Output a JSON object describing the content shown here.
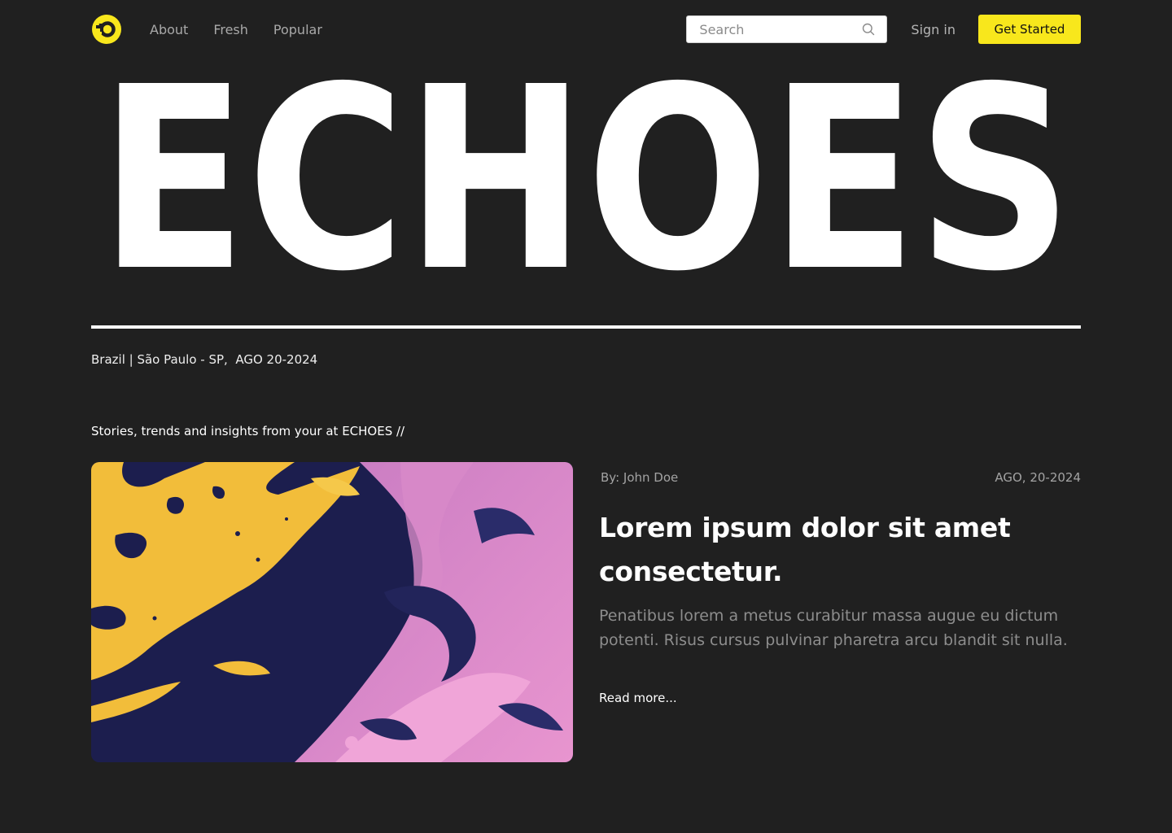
{
  "header": {
    "nav": [
      {
        "label": "About"
      },
      {
        "label": "Fresh"
      },
      {
        "label": "Popular"
      }
    ],
    "search": {
      "placeholder": "Search"
    },
    "signin_label": "Sign in",
    "cta_label": "Get Started"
  },
  "hero": {
    "title": "ECHOES",
    "location": "Brazil | São Paulo - SP,  AGO 20-2024",
    "tagline": "Stories, trends and insights from your at ECHOES //"
  },
  "feature": {
    "author": "By: John Doe",
    "date": "AGO, 20-2024",
    "title": "Lorem ipsum dolor sit amet consectetur.",
    "excerpt": "Penatibus lorem a metus curabitur massa augue eu dictum potenti. Risus cursus pulvinar pharetra arcu blandit sit nulla.",
    "read_more": "Read more..."
  },
  "colors": {
    "background": "#202020",
    "accent": "#f8e71c",
    "text": "#ffffff",
    "muted": "#8d8d8d"
  },
  "icons": {
    "logo": "refresh-logo-icon",
    "search": "search-icon"
  }
}
